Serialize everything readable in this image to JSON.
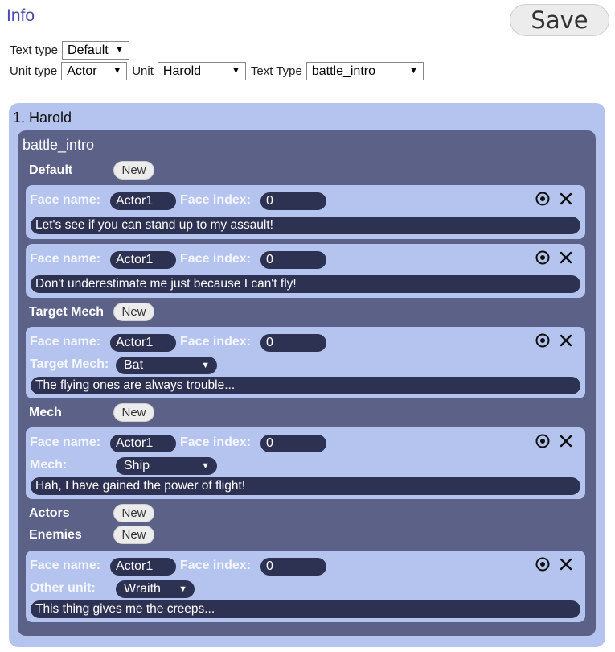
{
  "header": {
    "title": "Info",
    "save_label": "Save"
  },
  "filters": {
    "text_type_label": "Text type",
    "text_type_value": "Default",
    "unit_type_label": "Unit type",
    "unit_type_value": "Actor",
    "unit_label": "Unit",
    "unit_value": "Harold",
    "text_type2_label": "Text Type",
    "text_type2_value": "battle_intro"
  },
  "unit": {
    "title": "1. Harold",
    "group": {
      "title": "battle_intro",
      "new_label": "New",
      "face_name_label": "Face name:",
      "face_index_label": "Face index:",
      "sections": [
        {
          "label": "Default"
        },
        {
          "label": "Target Mech"
        },
        {
          "label": "Mech"
        },
        {
          "label": "Actors"
        },
        {
          "label": "Enemies"
        }
      ],
      "entries": [
        {
          "face_name": "Actor1",
          "face_index": "0",
          "text": "Let's see if you can stand up to my assault!"
        },
        {
          "face_name": "Actor1",
          "face_index": "0",
          "text": "Don't underestimate me just because I can't fly!"
        },
        {
          "face_name": "Actor1",
          "face_index": "0",
          "extra_label": "Target Mech:",
          "extra_value": "Bat",
          "text": "The flying ones are always trouble..."
        },
        {
          "face_name": "Actor1",
          "face_index": "0",
          "extra_label": "Mech:",
          "extra_value": "Ship",
          "text": "Hah, I have gained the power of flight!"
        },
        {
          "face_name": "Actor1",
          "face_index": "0",
          "extra_label": "Other unit:",
          "extra_value": "Wraith",
          "text": "This thing gives me the creeps..."
        }
      ]
    }
  },
  "colors": {
    "title": "#4a4ab0",
    "unit_bg": "#b5c3ef",
    "group_bg": "#5b6187",
    "pill_bg": "#2d3152"
  },
  "icons": {
    "preview": "eye-icon",
    "delete": "close-icon",
    "dropdown": "dropdown-arrow-icon"
  }
}
